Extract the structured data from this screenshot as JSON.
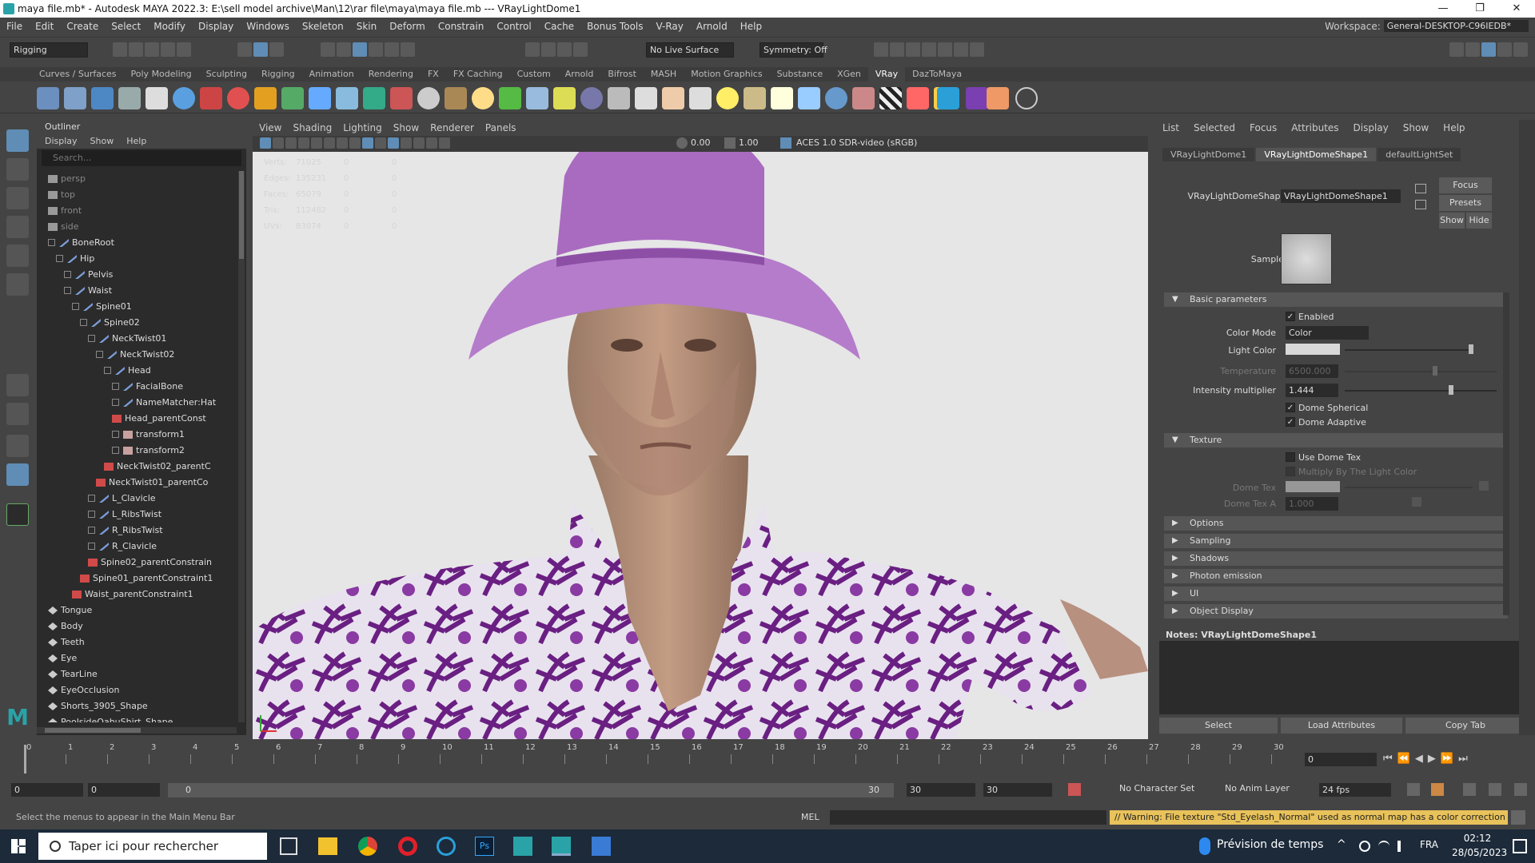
{
  "window": {
    "title": "maya file.mb* - Autodesk MAYA 2022.3: E:\\sell model archive\\Man\\12\\rar file\\maya\\maya file.mb  ---  VRayLightDome1",
    "buttons": [
      "—",
      "❐",
      "✕"
    ]
  },
  "menubar": {
    "items": [
      "File",
      "Edit",
      "Create",
      "Select",
      "Modify",
      "Display",
      "Windows",
      "Skeleton",
      "Skin",
      "Deform",
      "Constrain",
      "Control",
      "Cache",
      "Bonus Tools",
      "V-Ray",
      "Arnold",
      "Help"
    ],
    "workspace_label": "Workspace:",
    "workspace_value": "General-DESKTOP-C96IEDB*"
  },
  "statusline": {
    "mode": "Rigging",
    "live_surface": "No Live Surface",
    "symmetry": "Symmetry: Off"
  },
  "shelf": {
    "tabs": [
      "Curves / Surfaces",
      "Poly Modeling",
      "Sculpting",
      "Rigging",
      "Animation",
      "Rendering",
      "FX",
      "FX Caching",
      "Custom",
      "Arnold",
      "Bifrost",
      "MASH",
      "Motion Graphics",
      "Substance",
      "XGen",
      "VRay",
      "DazToMaya"
    ],
    "active_tab": "VRay"
  },
  "outliner": {
    "title": "Outliner",
    "menu": [
      "Display",
      "Show",
      "Help"
    ],
    "search_placeholder": "Search...",
    "rows": [
      {
        "label": "persp",
        "indent": 0,
        "type": "camera",
        "dim": true
      },
      {
        "label": "top",
        "indent": 0,
        "type": "camera",
        "dim": true
      },
      {
        "label": "front",
        "indent": 0,
        "type": "camera",
        "dim": true
      },
      {
        "label": "side",
        "indent": 0,
        "type": "camera",
        "dim": true
      },
      {
        "label": "BoneRoot",
        "indent": 0,
        "type": "joint",
        "exp": true
      },
      {
        "label": "Hip",
        "indent": 1,
        "type": "joint",
        "exp": true
      },
      {
        "label": "Pelvis",
        "indent": 2,
        "type": "joint",
        "exp": true
      },
      {
        "label": "Waist",
        "indent": 2,
        "type": "joint",
        "exp": true
      },
      {
        "label": "Spine01",
        "indent": 3,
        "type": "joint",
        "exp": true
      },
      {
        "label": "Spine02",
        "indent": 4,
        "type": "joint",
        "exp": true
      },
      {
        "label": "NeckTwist01",
        "indent": 5,
        "type": "joint",
        "exp": true
      },
      {
        "label": "NeckTwist02",
        "indent": 6,
        "type": "joint",
        "exp": true
      },
      {
        "label": "Head",
        "indent": 7,
        "type": "joint",
        "exp": true
      },
      {
        "label": "FacialBone",
        "indent": 8,
        "type": "joint",
        "exp": true
      },
      {
        "label": "NameMatcher:Hat",
        "indent": 8,
        "type": "joint",
        "exp": true
      },
      {
        "label": "Head_parentConst",
        "indent": 8,
        "type": "constraint",
        "exp": false
      },
      {
        "label": "transform1",
        "indent": 8,
        "type": "transform",
        "exp": true
      },
      {
        "label": "transform2",
        "indent": 8,
        "type": "transform",
        "exp": true
      },
      {
        "label": "NeckTwist02_parentC",
        "indent": 7,
        "type": "constraint",
        "exp": false
      },
      {
        "label": "NeckTwist01_parentCo",
        "indent": 6,
        "type": "constraint",
        "exp": false
      },
      {
        "label": "L_Clavicle",
        "indent": 5,
        "type": "joint",
        "exp": true
      },
      {
        "label": "L_RibsTwist",
        "indent": 5,
        "type": "joint",
        "exp": true
      },
      {
        "label": "R_RibsTwist",
        "indent": 5,
        "type": "joint",
        "exp": true
      },
      {
        "label": "R_Clavicle",
        "indent": 5,
        "type": "joint",
        "exp": true
      },
      {
        "label": "Spine02_parentConstrain",
        "indent": 5,
        "type": "constraint",
        "exp": false
      },
      {
        "label": "Spine01_parentConstraint1",
        "indent": 4,
        "type": "constraint",
        "exp": false
      },
      {
        "label": "Waist_parentConstraint1",
        "indent": 3,
        "type": "constraint",
        "exp": false
      },
      {
        "label": "Tongue",
        "indent": 0,
        "type": "mesh",
        "exp": false
      },
      {
        "label": "Body",
        "indent": 0,
        "type": "mesh",
        "exp": false
      },
      {
        "label": "Teeth",
        "indent": 0,
        "type": "mesh",
        "exp": false
      },
      {
        "label": "Eye",
        "indent": 0,
        "type": "mesh",
        "exp": false
      },
      {
        "label": "TearLine",
        "indent": 0,
        "type": "mesh",
        "exp": false
      },
      {
        "label": "EyeOcclusion",
        "indent": 0,
        "type": "mesh",
        "exp": false
      },
      {
        "label": "Shorts_3905_Shape",
        "indent": 0,
        "type": "mesh",
        "exp": false
      },
      {
        "label": "PoolsideOahuShirt_Shape",
        "indent": 0,
        "type": "mesh",
        "exp": false
      }
    ]
  },
  "viewport": {
    "menu": [
      "View",
      "Shading",
      "Lighting",
      "Show",
      "Renderer",
      "Panels"
    ],
    "exposure": "0.00",
    "gamma": "1.00",
    "colorspace": "ACES 1.0 SDR-video (sRGB)",
    "stats": [
      {
        "label": "Verts:",
        "a": "71025",
        "b": "0",
        "c": "0"
      },
      {
        "label": "Edges:",
        "a": "135231",
        "b": "0",
        "c": "0"
      },
      {
        "label": "Faces:",
        "a": "65079",
        "b": "0",
        "c": "0"
      },
      {
        "label": "Tris:",
        "a": "112482",
        "b": "0",
        "c": "0"
      },
      {
        "label": "UVs:",
        "a": "83074",
        "b": "0",
        "c": "0"
      }
    ]
  },
  "attr": {
    "menu": [
      "List",
      "Selected",
      "Focus",
      "Attributes",
      "Display",
      "Show",
      "Help"
    ],
    "tabs": [
      "VRayLightDome1",
      "VRayLightDomeShape1",
      "defaultLightSet"
    ],
    "active_tab": "VRayLightDomeShape1",
    "shape_label": "VRayLightDomeShape:",
    "shape_value": "VRayLightDomeShape1",
    "side_buttons": [
      "Focus",
      "Presets",
      "Show",
      "Hide"
    ],
    "sample_label": "Sample",
    "sections": {
      "basic": "Basic parameters",
      "texture": "Texture",
      "options": "Options",
      "sampling": "Sampling",
      "shadows": "Shadows",
      "photon": "Photon emission",
      "ui": "UI",
      "object_display": "Object Display"
    },
    "enabled": "Enabled",
    "color_mode_label": "Color Mode",
    "color_mode_value": "Color",
    "light_color_label": "Light Color",
    "temperature_label": "Temperature",
    "temperature_value": "6500.000",
    "intensity_label": "Intensity multiplier",
    "intensity_value": "1.444",
    "dome_spherical": "Dome Spherical",
    "dome_adaptive": "Dome Adaptive",
    "use_dome_tex": "Use Dome Tex",
    "multiply": "Multiply By The Light Color",
    "dome_tex_label": "Dome Tex",
    "dome_tex_a_label": "Dome Tex A",
    "dome_tex_a_value": "1.000",
    "notes": "Notes:  VRayLightDomeShape1",
    "bottom_buttons": [
      "Select",
      "Load Attributes",
      "Copy Tab"
    ]
  },
  "timeline": {
    "ticks": [
      "0",
      "1",
      "2",
      "3",
      "4",
      "5",
      "6",
      "7",
      "8",
      "9",
      "10",
      "11",
      "12",
      "13",
      "14",
      "15",
      "16",
      "17",
      "18",
      "19",
      "20",
      "21",
      "22",
      "23",
      "24",
      "25",
      "26",
      "27",
      "28",
      "29",
      "30"
    ],
    "current_frame": "0"
  },
  "range": {
    "start": "0",
    "start2": "0",
    "slider_start": "0",
    "slider_end": "30",
    "end": "30",
    "end2": "30",
    "character_set": "No Character Set",
    "anim_layer": "No Anim Layer",
    "fps": "24 fps"
  },
  "cmdline": {
    "help": "Select the menus to appear in the Main Menu Bar",
    "lang": "MEL",
    "warning": "// Warning: File texture \"Std_Eyelash_Normal\" used as normal map has a color correction enable"
  },
  "taskbar": {
    "search": "Taper ici pour rechercher",
    "weather": "Prévision de temps",
    "lang": "FRA",
    "time": "02:12",
    "date": "28/05/2023"
  },
  "colors": {
    "accent": "#5f8db5",
    "hat": "#a96bc0",
    "shirt": "#7b2b8f"
  }
}
